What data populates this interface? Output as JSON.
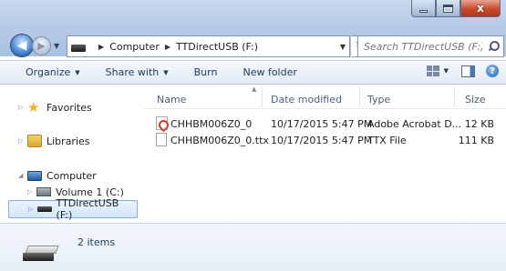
{
  "window": {
    "caption_buttons": {
      "minimize": "–",
      "maximize": "□",
      "close": "x"
    }
  },
  "address": {
    "root_crumb": "Computer",
    "crumbs": [
      "Computer",
      "TTDirectUSB (F:)"
    ],
    "search_placeholder": "Search TTDirectUSB (F:)"
  },
  "toolbar": {
    "organize": "Organize",
    "share_with": "Share with",
    "burn": "Burn",
    "new_folder": "New folder"
  },
  "navigation": {
    "favorites": "Favorites",
    "libraries": "Libraries",
    "computer": "Computer",
    "volume": "Volume 1 (C:)",
    "ttdirect": "TTDirectUSB (F:)"
  },
  "file_list": {
    "columns": [
      "Name",
      "Date modified",
      "Type",
      "Size"
    ],
    "rows": [
      {
        "name": "CHHBM006Z0_0",
        "date": "10/17/2015 5:47 PM",
        "type": "Adobe Acrobat D...",
        "size": "12 KB",
        "icon": "pdf-icon"
      },
      {
        "name": "CHHBM006Z0_0.ttx",
        "date": "10/17/2015 5:47 PM",
        "type": "TTX File",
        "size": "111 KB",
        "icon": "blank-file-icon"
      }
    ]
  },
  "details": {
    "item_count": "2 items"
  }
}
